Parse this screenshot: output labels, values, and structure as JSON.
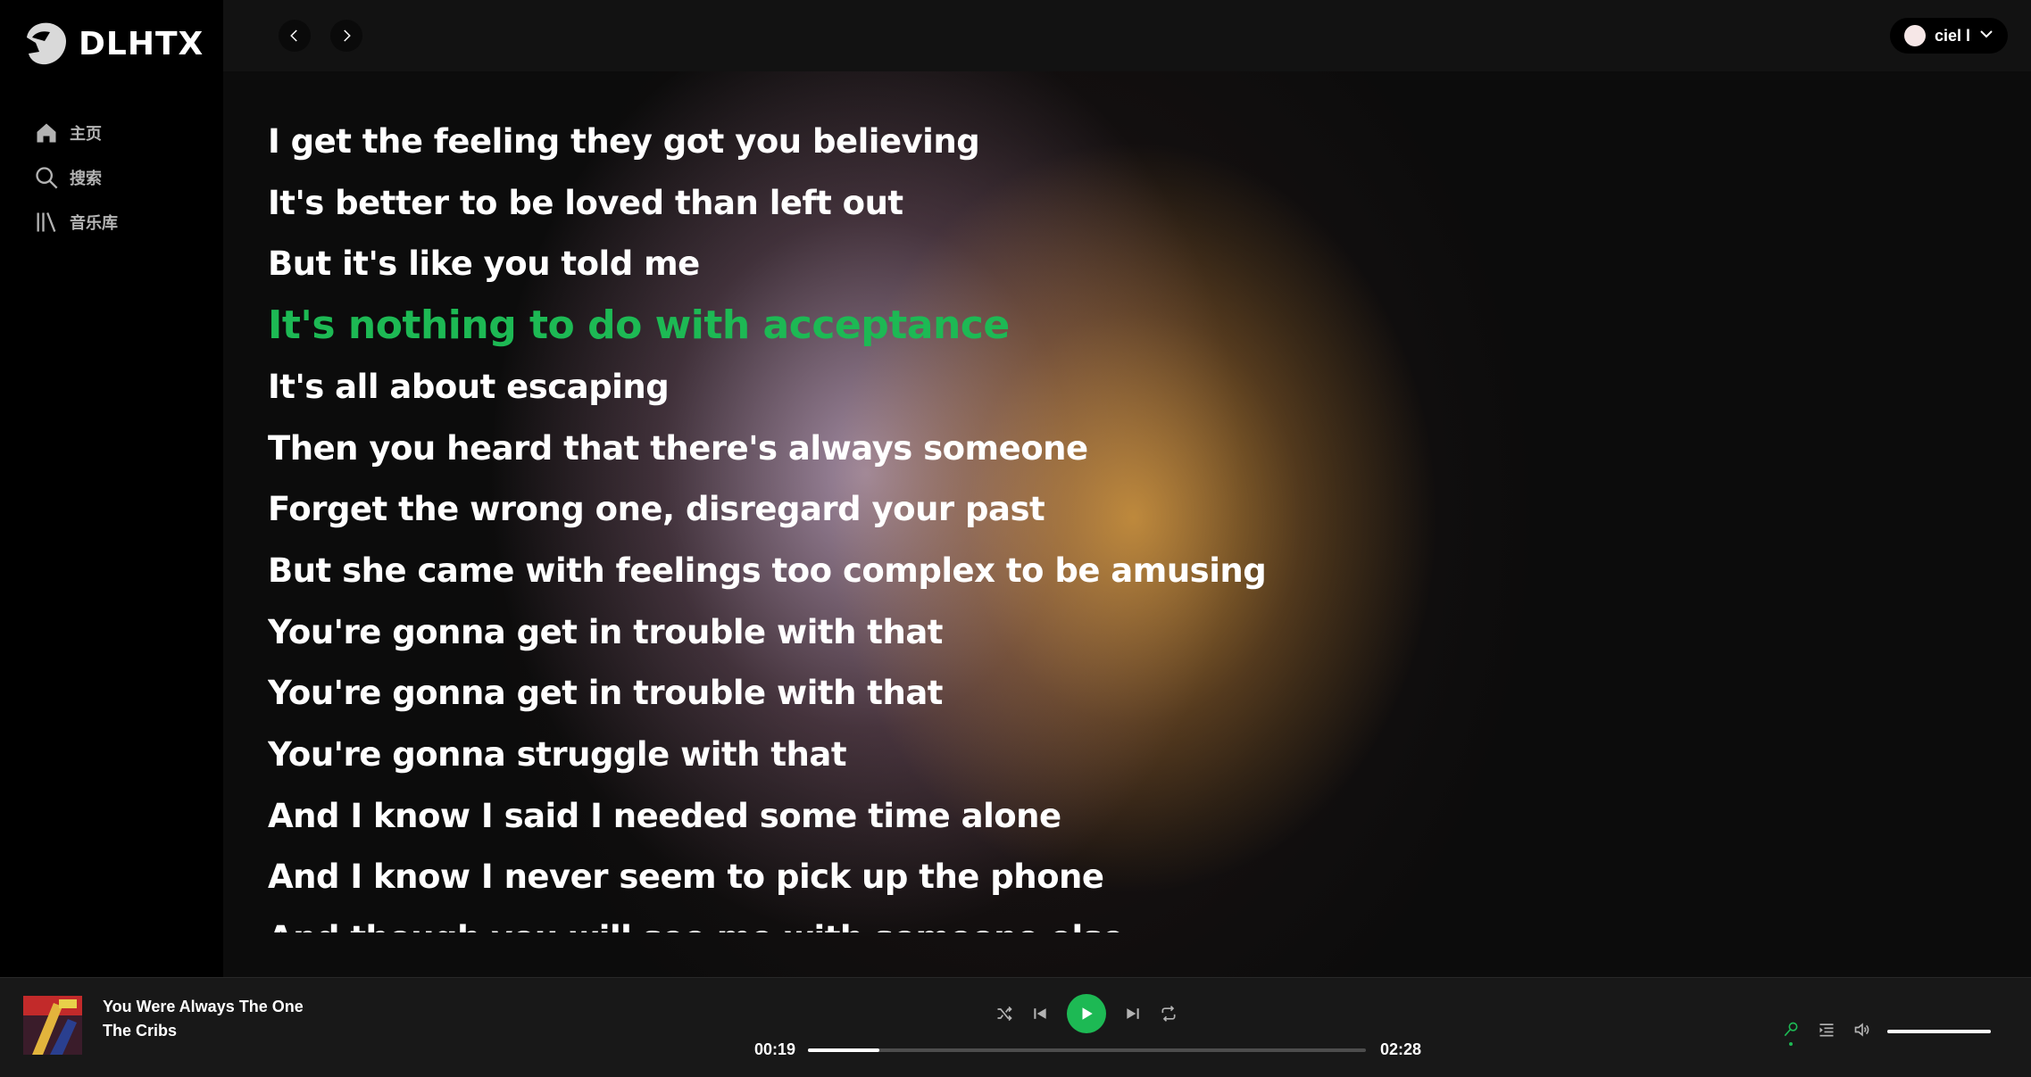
{
  "app": {
    "name": "DLHTX"
  },
  "sidebar": {
    "items": [
      {
        "label": "主页",
        "icon": "home-icon"
      },
      {
        "label": "搜索",
        "icon": "search-icon"
      },
      {
        "label": "音乐库",
        "icon": "library-icon"
      }
    ]
  },
  "header": {
    "back_icon": "chevron-left-icon",
    "forward_icon": "chevron-right-icon",
    "user": {
      "name": "ciel l"
    }
  },
  "lyrics": {
    "lines": [
      "I get the feeling they got you believing",
      "It's better to be loved than left out",
      "But it's like you told me",
      "It's nothing to do with acceptance",
      "It's all about escaping",
      "Then you heard that there's always someone",
      "Forget the wrong one, disregard your past",
      "But she came with feelings too complex to be amusing",
      "You're gonna get in trouble with that",
      "You're gonna get in trouble with that",
      "You're gonna struggle with that",
      "And I know I said I needed some time alone",
      "And I know I never seem to pick up the phone",
      "And though you will see me with someone else"
    ],
    "active_index": 3
  },
  "player": {
    "track_title": "You Were Always The One",
    "artist": "The Cribs",
    "current_time": "00:19",
    "total_time": "02:28",
    "progress": 0.128,
    "volume": 1.0,
    "accent_color": "#1db954"
  }
}
